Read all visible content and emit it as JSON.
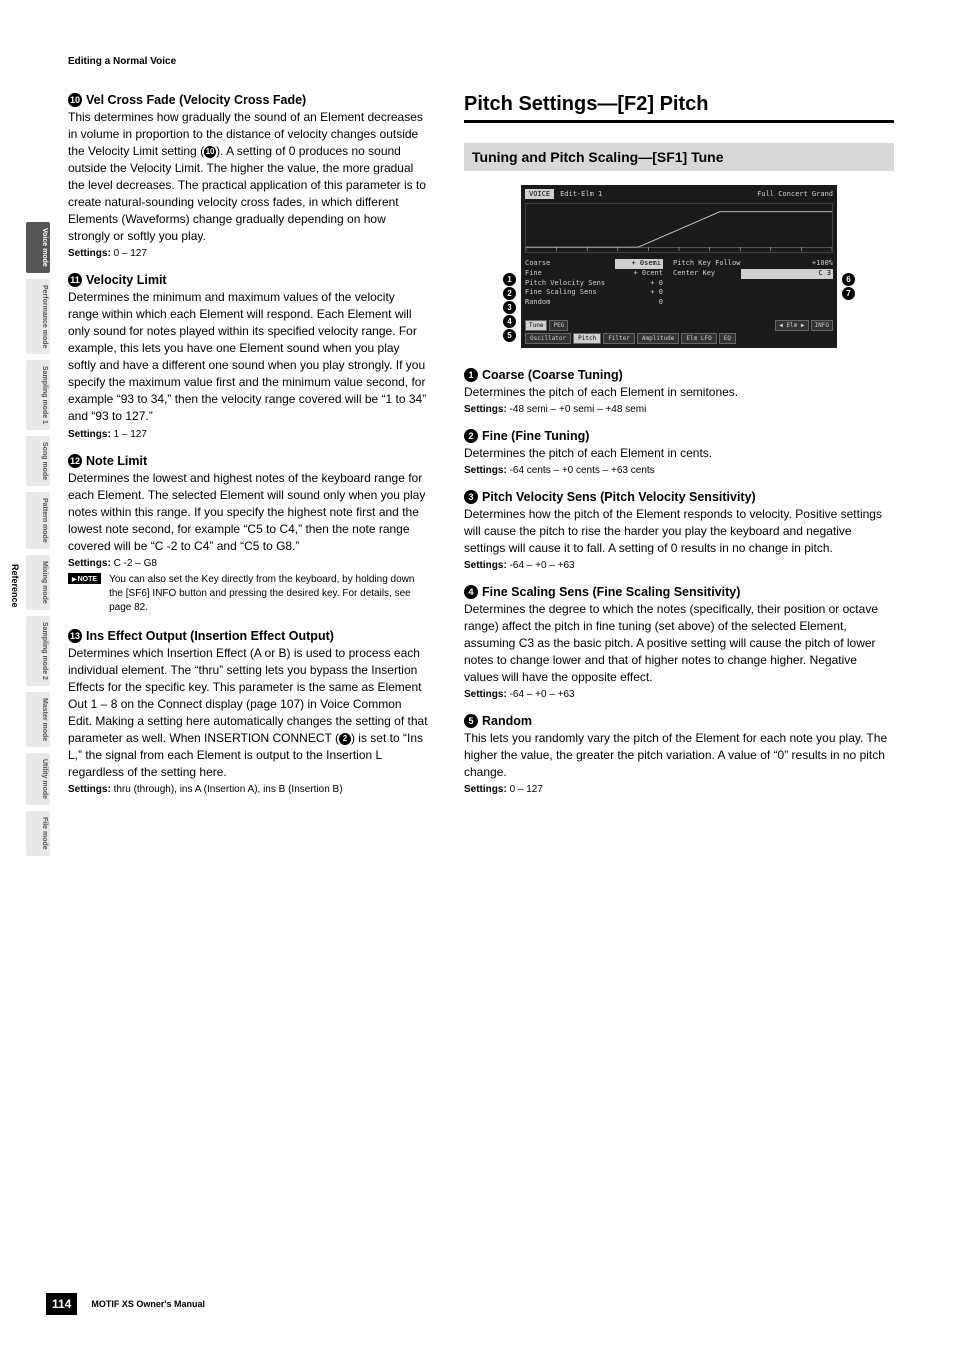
{
  "breadcrumb": "Editing a Normal Voice",
  "side_tabs": [
    {
      "label": "Voice mode",
      "active": true
    },
    {
      "label": "Performance mode",
      "active": false
    },
    {
      "label": "Sampling mode 1",
      "active": false
    },
    {
      "label": "Song mode",
      "active": false
    },
    {
      "label": "Pattern mode",
      "active": false
    },
    {
      "label": "Mixing mode",
      "active": false
    },
    {
      "label": "Sampling mode 2",
      "active": false
    },
    {
      "label": "Master mode",
      "active": false
    },
    {
      "label": "Utility mode",
      "active": false
    },
    {
      "label": "File mode",
      "active": false
    }
  ],
  "reference_label": "Reference",
  "left": {
    "p10": {
      "num": "10",
      "title": "Vel Cross Fade (Velocity Cross Fade)",
      "body": "This determines how gradually the sound of an Element decreases in volume in proportion to the distance of velocity changes outside the Velocity Limit setting (",
      "body2": "). A setting of 0 produces no sound outside the Velocity Limit. The higher the value, the more gradual the level decreases. The practical application of this parameter is to create natural-sounding velocity cross fades, in which different Elements (Waveforms) change gradually depending on how strongly or softly you play.",
      "ref_num": "10",
      "settings": "0 – 127"
    },
    "p11": {
      "num": "11",
      "title": "Velocity Limit",
      "body": "Determines the minimum and maximum values of the velocity range within which each Element will respond. Each Element will only sound for notes played within its specified velocity range. For example, this lets you have one Element sound when you play softly and have a different one sound when you play strongly. If you specify the maximum value first and the minimum value second, for example “93 to 34,” then the velocity range covered will be “1 to 34” and “93 to 127.”",
      "settings": "1 – 127"
    },
    "p12": {
      "num": "12",
      "title": "Note Limit",
      "body": "Determines the lowest and highest notes of the keyboard range for each Element. The selected Element will sound only when you play notes within this range. If you specify the highest note first and the lowest note second, for example “C5 to C4,” then the note range covered will be “C -2 to C4” and “C5 to G8.”",
      "settings": "C -2 – G8",
      "note": "You can also set the Key directly from the keyboard, by holding down the [SF6] INFO button and pressing the desired key. For details, see page 82."
    },
    "p13": {
      "num": "13",
      "title": "Ins Effect Output (Insertion Effect Output)",
      "body": "Determines which Insertion Effect (A or B) is used to process each individual element. The “thru” setting lets you bypass the Insertion Effects for the specific key. This parameter is the same as Element Out 1 – 8 on the Connect display (page 107) in Voice Common Edit. Making a setting here automatically changes the setting of that parameter as well. When INSERTION CONNECT (",
      "body2": ") is set to “Ins L,” the signal from each Element is output to the Insertion L regardless of the setting here.",
      "ref_num": "2",
      "settings": "thru (through), ins A (Insertion A), ins B (Insertion B)"
    }
  },
  "right": {
    "section_title": "Pitch Settings—[F2] Pitch",
    "subsection": "Tuning and Pitch Scaling—[SF1] Tune",
    "screenshot": {
      "header": {
        "voice": "VOICE",
        "edit": "Edit-Elm 1",
        "preset": "Full Concert Grand"
      },
      "rows": [
        {
          "label": "Coarse",
          "val": "+ 0semi",
          "label2": "Pitch Key Follow",
          "val2": "+100%"
        },
        {
          "label": "Fine",
          "val": "+ 0cent",
          "label2": "Center Key",
          "val2": "C  3"
        },
        {
          "label": "Pitch Velocity Sens",
          "val": "+ 0",
          "label2": "",
          "val2": ""
        },
        {
          "label": "Fine Scaling Sens",
          "val": "+ 0",
          "label2": "",
          "val2": ""
        },
        {
          "label": "Random",
          "val": "0",
          "label2": "",
          "val2": ""
        }
      ],
      "tabs1": [
        "Tune",
        "PEG",
        "",
        "",
        "◀ Elm ▶",
        "INFO"
      ],
      "tabs2": [
        "Oscillator",
        "Pitch",
        "Filter",
        "Amplitude",
        "Elm LFO",
        "EQ"
      ]
    },
    "p1": {
      "num": "1",
      "title": "Coarse (Coarse Tuning)",
      "body": "Determines the pitch of each Element in semitones.",
      "settings": "-48 semi – +0 semi – +48 semi"
    },
    "p2": {
      "num": "2",
      "title": "Fine (Fine Tuning)",
      "body": "Determines the pitch of each Element in cents.",
      "settings": "-64 cents – +0 cents – +63 cents"
    },
    "p3": {
      "num": "3",
      "title": "Pitch Velocity Sens (Pitch Velocity Sensitivity)",
      "body": "Determines how the pitch of the Element responds to velocity. Positive settings will cause the pitch to rise the harder you play the keyboard and negative settings will cause it to fall. A setting of 0 results in no change in pitch.",
      "settings": "-64 – +0 – +63"
    },
    "p4": {
      "num": "4",
      "title": "Fine Scaling Sens (Fine Scaling Sensitivity)",
      "body": "Determines the degree to which the notes (specifically, their position or octave range) affect the pitch in fine tuning (set above) of the selected Element, assuming C3 as the basic pitch. A positive setting will cause the pitch of lower notes to change lower and that of higher notes to change higher. Negative values will have the opposite effect.",
      "settings": "-64 – +0 – +63"
    },
    "p5": {
      "num": "5",
      "title": "Random",
      "body": "This lets you randomly vary the pitch of the Element for each note you play. The higher the value, the greater the pitch variation. A value of “0” results in no pitch change.",
      "settings": "0 – 127"
    }
  },
  "settings_label": "Settings:",
  "note_label": "NOTE",
  "footer": {
    "page": "114",
    "manual": "MOTIF XS Owner's Manual"
  }
}
